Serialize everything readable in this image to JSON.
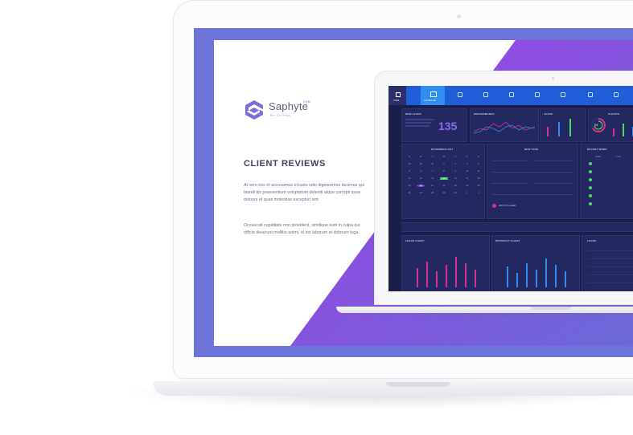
{
  "brand": {
    "name": "Saphyte",
    "superscript": "CRM",
    "byline": "BY CLYPSA"
  },
  "slide": {
    "heading": "CLIENT REVIEWS",
    "paragraph1": "At vero eos et accusamus et iusto odio dignissimos ducimus qui blandi tiis praesentium voluptatum deleniti atque corrupti quos dolores et quas molestias excepturi sint",
    "paragraph2": "Occaecati cupiditate non provident, similique sunt in culpa qui officia deserunt mollitia animi, id est laborum et dolorum fuga."
  },
  "colors": {
    "screen_bg": "#6e73d8",
    "purple_accent": "#8b3de0",
    "dashboard_bg": "#1a1f4a",
    "nav_blue": "#1f5ed8",
    "active_blue": "#2f8ef0",
    "magenta": "#d6318f",
    "green": "#4cd964"
  },
  "dashboard": {
    "nav": [
      "HOME",
      "DASHBOARD",
      "",
      "",
      "",
      "",
      "",
      "",
      "",
      ""
    ],
    "new_leads": {
      "title": "NEW LEADS",
      "value": "135"
    },
    "performance": {
      "title": "PERFORMANCE"
    },
    "leads": {
      "title": "LEADS"
    },
    "clients": {
      "title": "CLIENTS",
      "percent": "53"
    },
    "calendar": {
      "month": "NOVEMBER 2017",
      "weekdays": [
        "S",
        "M",
        "T",
        "W",
        "T",
        "F",
        "S"
      ],
      "rows": [
        [
          "29",
          "30",
          "31",
          "1",
          "2",
          "3",
          "4"
        ],
        [
          "5",
          "6",
          "7",
          "8",
          "9",
          "10",
          "11"
        ],
        [
          "12",
          "13",
          "14",
          "15",
          "16",
          "17",
          "18"
        ],
        [
          "19",
          "20",
          "21",
          "22",
          "23",
          "24",
          "25"
        ],
        [
          "26",
          "27",
          "28",
          "29",
          "30",
          "1",
          "2"
        ]
      ]
    },
    "new_task": {
      "title": "NEW TASK",
      "add_label": "ADD TO MY WORK"
    },
    "recent_work": {
      "title": "RECENT WORK",
      "cols": [
        "NAME",
        "TYPE"
      ]
    },
    "leads_chart": {
      "title": "LEADS CHART"
    },
    "prospect_chart": {
      "title": "PROSPECT CHART"
    },
    "leads_table": {
      "title": "LEADS"
    }
  }
}
